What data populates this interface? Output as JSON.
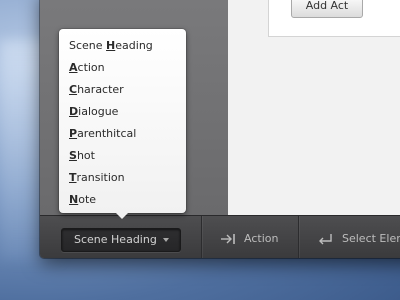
{
  "document": {
    "add_act_label": "Add Act"
  },
  "element_menu": {
    "items": [
      {
        "pre": "Scene ",
        "key": "H",
        "post": "eading"
      },
      {
        "pre": "",
        "key": "A",
        "post": "ction"
      },
      {
        "pre": "",
        "key": "C",
        "post": "haracter"
      },
      {
        "pre": "",
        "key": "D",
        "post": "ialogue"
      },
      {
        "pre": "",
        "key": "P",
        "post": "arenthitcal"
      },
      {
        "pre": "",
        "key": "S",
        "post": "hot"
      },
      {
        "pre": "",
        "key": "T",
        "post": "ransition"
      },
      {
        "pre": "",
        "key": "N",
        "post": "ote"
      }
    ]
  },
  "toolbar": {
    "selected_element": "Scene Heading",
    "tab_action_label": "Action",
    "return_action_label": "Select Element",
    "tab_icon": "tab-arrow-icon",
    "return_icon": "return-arrow-icon"
  }
}
